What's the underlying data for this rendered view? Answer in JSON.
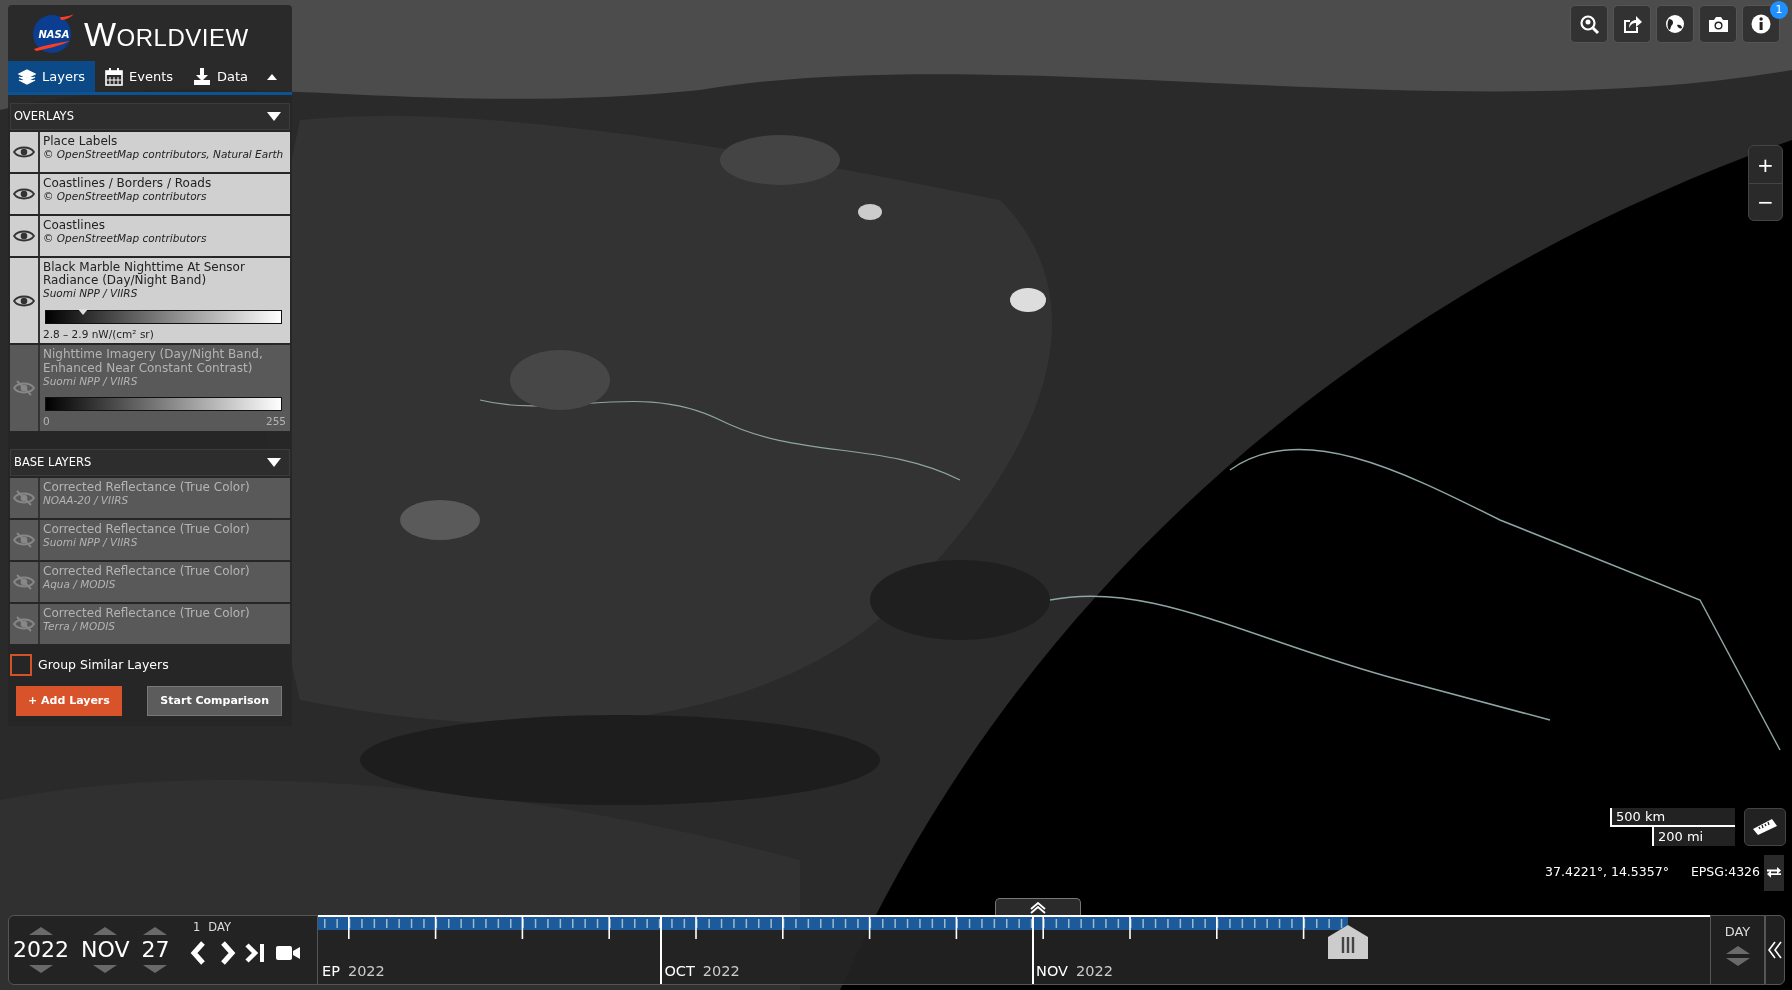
{
  "app": {
    "logo_text": "NASA",
    "title": "WORLDVIEW"
  },
  "tabs": [
    {
      "label": "Layers",
      "selected": true
    },
    {
      "label": "Events",
      "selected": false
    },
    {
      "label": "Data",
      "selected": false
    }
  ],
  "sections": [
    {
      "title": "OVERLAYS",
      "expanded": true,
      "layers": [
        {
          "name": "Place Labels",
          "source": "© OpenStreetMap contributors, Natural Earth",
          "visible": true
        },
        {
          "name": "Coastlines / Borders / Roads",
          "source": "© OpenStreetMap contributors",
          "visible": true
        },
        {
          "name": "Coastlines",
          "source": "© OpenStreetMap contributors",
          "visible": true
        },
        {
          "name": "Black Marble Nighttime At Sensor Radiance (Day/Night Band)",
          "source": "Suomi NPP / VIIRS",
          "visible": true,
          "legend": {
            "kind": "value",
            "label": "2.8 – 2.9 nW/(cm² sr)",
            "level": 0.16
          }
        },
        {
          "name": "Nighttime Imagery (Day/Night Band, Enhanced Near Constant Contrast)",
          "source": "Suomi NPP / VIIRS",
          "visible": false,
          "legend": {
            "kind": "range",
            "min": "0",
            "max": "255"
          }
        }
      ]
    },
    {
      "title": "BASE LAYERS",
      "expanded": true,
      "layers": [
        {
          "name": "Corrected Reflectance (True Color)",
          "source": "NOAA-20 / VIIRS",
          "visible": false
        },
        {
          "name": "Corrected Reflectance (True Color)",
          "source": "Suomi NPP / VIIRS",
          "visible": false
        },
        {
          "name": "Corrected Reflectance (True Color)",
          "source": "Aqua / MODIS",
          "visible": false
        },
        {
          "name": "Corrected Reflectance (True Color)",
          "source": "Terra / MODIS",
          "visible": false
        }
      ]
    }
  ],
  "group_similar": {
    "label": "Group Similar Layers",
    "checked": false
  },
  "buttons": [
    {
      "label": "+ Add Layers",
      "kind": "primary"
    },
    {
      "label": "Start Comparison",
      "kind": "secondary"
    }
  ],
  "toolbar": {
    "info_badge": "1"
  },
  "zoom": {
    "in": "+",
    "out": "−"
  },
  "scale": {
    "metric": "500 km",
    "imperial": "200 mi"
  },
  "coordinates": {
    "latlon": "37.4221°, 14.5357°",
    "projection": "EPSG:4326"
  },
  "timeline": {
    "year": "2022",
    "month": "NOV",
    "day": "27",
    "interval_count": "1",
    "interval_unit": "DAY",
    "zoom_level": "DAY",
    "level": 0.74,
    "months": [
      {
        "label": "EP",
        "year": "2022"
      },
      {
        "label": "OCT",
        "year": "2022"
      },
      {
        "label": "NOV",
        "year": "2022"
      }
    ]
  }
}
